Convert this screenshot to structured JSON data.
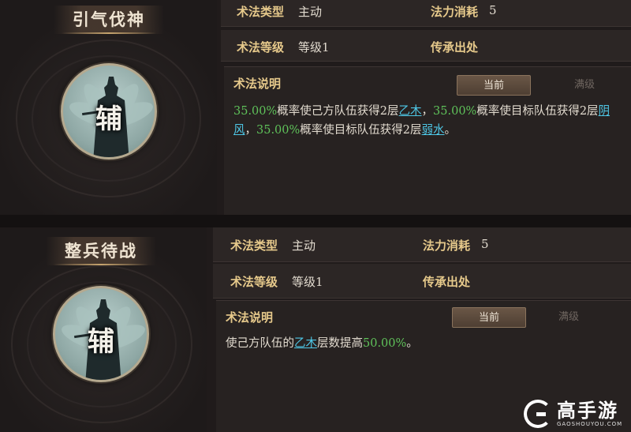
{
  "skills": [
    {
      "name": "引气伐神",
      "role": "辅",
      "type_label": "术法类型",
      "type_value": "主动",
      "cost_label": "法力消耗",
      "cost_value": "5",
      "level_label": "术法等级",
      "level_value": "等级1",
      "source_label": "传承出处",
      "desc_title": "术法说明",
      "tab_current": "当前",
      "tab_max": "满级",
      "desc": {
        "p1": "35.00%",
        "t1": "概率使己方队伍获得2层",
        "b1": "乙木",
        "t2": "，",
        "p2": "35.00%",
        "t3": "概率使目标队伍获得2层",
        "b2": "阴风",
        "t4": "，",
        "p3": "35.00%",
        "t5": "概率使目标队伍获得2层",
        "b3": "弱水",
        "t6": "。"
      }
    },
    {
      "name": "整兵待战",
      "role": "辅",
      "type_label": "术法类型",
      "type_value": "主动",
      "cost_label": "法力消耗",
      "cost_value": "5",
      "level_label": "术法等级",
      "level_value": "等级1",
      "source_label": "传承出处",
      "desc_title": "术法说明",
      "tab_current": "当前",
      "tab_max": "满级",
      "desc": {
        "t1": "使己方队伍的",
        "b1": "乙木",
        "t2": "层数提高",
        "p1": "50.00%",
        "t3": "。"
      }
    }
  ],
  "watermark": {
    "main": "高手游",
    "sub": "GAOSHOUYOU.COM"
  },
  "colors": {
    "background": "#201b1b",
    "label_gold": "#e6c98b",
    "percent_green": "#5fc25a",
    "buff_cyan": "#4ec7e6"
  }
}
